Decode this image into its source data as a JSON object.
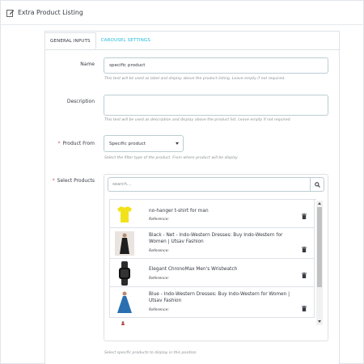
{
  "header": {
    "title": "Extra Product Listing",
    "icon": "edit-icon"
  },
  "tabs": [
    {
      "label": "GENERAL INPUTS",
      "active": true
    },
    {
      "label": "CAROUSEL SETTINGS",
      "active": false
    }
  ],
  "form": {
    "name": {
      "label": "Name",
      "value": "specific product",
      "help": "This text will be used as label and display above the product listing. Leave empty if not required."
    },
    "description": {
      "label": "Description",
      "value": "",
      "help": "This text will be used as description and display above the product list. Leave empty if not required."
    },
    "product_from": {
      "label": "Product From",
      "required": "*",
      "selected": "Specific product",
      "help": "Select the filter type of the product. From where product will be display."
    },
    "select_products": {
      "label": "Select Products",
      "required": "*",
      "search_placeholder": "search...",
      "help": "Select specific products to display in this position"
    }
  },
  "products": [
    {
      "name": "no-hanger t-shirt for man",
      "reference": "Reference:",
      "thumb_color": "#f2e21a"
    },
    {
      "name": "Black - Net - Indo-Western Dresses: Buy Indo-Western for Women | Utsav Fashion",
      "reference": "Reference:",
      "thumb_color": "#1e1e1e"
    },
    {
      "name": "Elegant ChronoMax Men's Wristwatch",
      "reference": "Reference:",
      "thumb_color": "#2b2b2b"
    },
    {
      "name": "Blue - Indo-Western Dresses: Buy Indo-Western for Women | Utsav Fashion",
      "reference": "Reference:",
      "thumb_color": "#2a6fb0"
    }
  ],
  "colors": {
    "accent": "#25b9d7",
    "required": "#c05c67",
    "border": "#bbcdd2"
  }
}
